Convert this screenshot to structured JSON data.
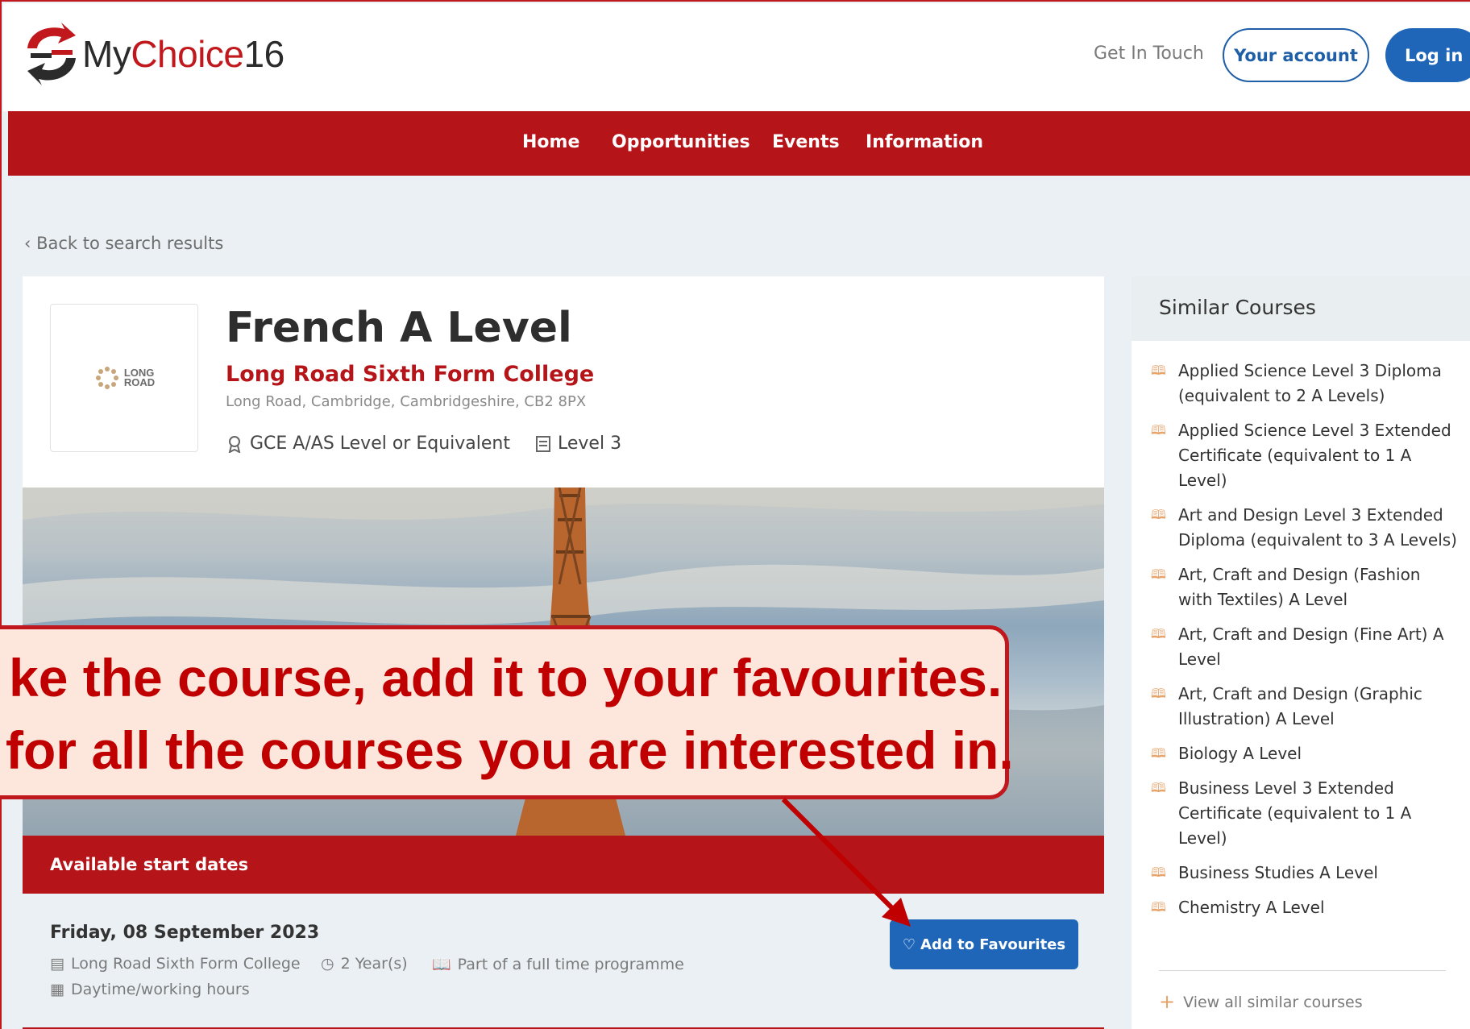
{
  "header": {
    "logo": {
      "my": "My",
      "choice": "Choice",
      "num": "16"
    },
    "get_in_touch": "Get In Touch",
    "your_account": "Your account",
    "log_in": "Log in"
  },
  "nav": [
    "Home",
    "Opportunities",
    "Events",
    "Information"
  ],
  "breadcrumb": {
    "back": "Back to search results"
  },
  "course": {
    "title": "French A Level",
    "college": "Long Road Sixth Form College",
    "address": "Long Road, Cambridge, Cambridgeshire, CB2 8PX",
    "qualification": "GCE A/AS Level or Equivalent",
    "level": "Level 3",
    "college_logo": {
      "line1": "LONG",
      "line2": "ROAD"
    }
  },
  "start_dates": {
    "heading": "Available start dates",
    "date": "Friday, 08 September 2023",
    "location": "Long Road Sixth Form College",
    "duration": "2 Year(s)",
    "mode": "Part of a full time programme",
    "hours": "Daytime/working hours",
    "add_button": "Add to Favourites"
  },
  "similar": {
    "heading": "Similar Courses",
    "items": [
      "Applied Science Level 3 Diploma (equivalent to 2 A Levels)",
      "Applied Science Level 3 Extended Certificate (equivalent to 1 A Level)",
      "Art and Design Level 3 Extended Diploma (equivalent to 3 A Levels)",
      "Art, Craft and Design (Fashion with Textiles) A Level",
      "Art, Craft and Design (Fine Art) A Level",
      "Art, Craft and Design (Graphic Illustration) A Level",
      "Biology A Level",
      "Business Level 3 Extended Certificate (equivalent to 1 A Level)",
      "Business Studies A Level",
      "Chemistry A Level"
    ],
    "view_all": "View all similar courses"
  },
  "callout": {
    "line1": "ke the course, add it to your favourites.",
    "line2": "for all the courses you are interested in."
  },
  "colors": {
    "brand_red": "#b51419",
    "brand_blue": "#1f66b8",
    "callout_text": "#c00000",
    "callout_bg": "#fde6dc"
  }
}
